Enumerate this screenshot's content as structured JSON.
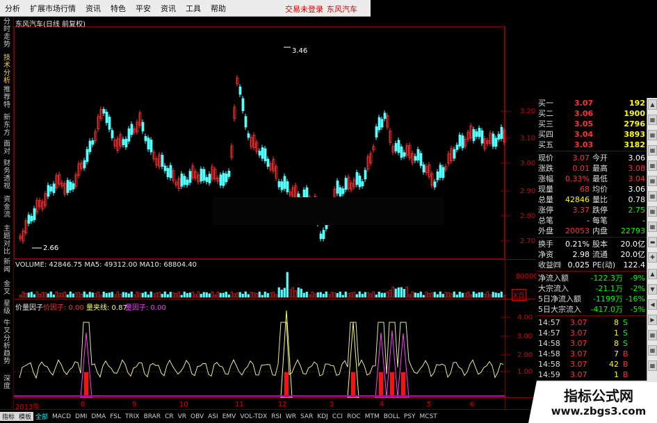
{
  "menu": {
    "items": [
      "分析",
      "扩展市场行情",
      "资讯",
      "特色",
      "平安",
      "资讯",
      "工具",
      "帮助"
    ],
    "trade_link": "交易未登录",
    "stock_link": "东风汽车"
  },
  "left_tabs": [
    "分时走势",
    "技术分析",
    "推荐特",
    "新东方",
    "面对",
    "财务透视",
    "资金流",
    "主题对比",
    "新闻",
    "金叉",
    "星级",
    "牛叉分析",
    "趋势",
    "深度"
  ],
  "chart": {
    "title": "东风汽车(日线 前复权)",
    "high_label": "3.46",
    "low_label": "2.66",
    "price_axis": [
      "3.20",
      "3.10",
      "3.00",
      "2.90",
      "2.80",
      "2.70"
    ],
    "volume_label": "VOLUME: 42846.75  MA5: 49312.00  MA10: 68804.40",
    "volume_axis": [
      "80000",
      "X百"
    ],
    "indicator_name": "价量因子",
    "indicator_items": [
      {
        "label": "价因子: 0.00",
        "color": "#ff3030"
      },
      {
        "label": "量夹线: 0.87",
        "color": "#ffff60"
      },
      {
        "label": "量因子: 0.00",
        "color": "#ff40ff"
      }
    ],
    "indicator_axis": [
      "4.00",
      "3.00",
      "2.00",
      "1.00"
    ],
    "x_axis": [
      "2013年",
      "8",
      "9",
      "10",
      "11",
      "12",
      "3",
      "4",
      "5",
      "6"
    ]
  },
  "quote": {
    "bids": [
      {
        "label": "买一",
        "price": "3.07",
        "vol": "192"
      },
      {
        "label": "买二",
        "price": "3.06",
        "vol": "1900"
      },
      {
        "label": "买三",
        "price": "3.05",
        "vol": "2796"
      },
      {
        "label": "买四",
        "price": "3.04",
        "vol": "3893"
      },
      {
        "label": "买五",
        "price": "3.03",
        "vol": "3182"
      }
    ],
    "stats": [
      {
        "l1": "现价",
        "v1": "3.07",
        "l2": "今开",
        "v2": "3.06"
      },
      {
        "l1": "涨跌",
        "v1": "0.01",
        "l2": "最高",
        "v2": "3.08"
      },
      {
        "l1": "涨幅",
        "v1": "0.33%",
        "l2": "最低",
        "v2": "3.04"
      },
      {
        "l1": "现量",
        "v1": "68",
        "l2": "均价",
        "v2": "3.06"
      },
      {
        "l1": "总量",
        "v1": "42846",
        "l2": "量比",
        "v2": "0.78"
      },
      {
        "l1": "涨停",
        "v1": "3.37",
        "l2": "跌停",
        "v2": "2.75"
      },
      {
        "l1": "总笔",
        "v1": "-",
        "l2": "每笔",
        "v2": "-"
      },
      {
        "l1": "外盘",
        "v1": "20053",
        "l2": "内盘",
        "v2": "22793"
      }
    ],
    "finance": [
      {
        "l1": "换手",
        "v1": "0.21%",
        "l2": "股本",
        "v2": "20.0亿"
      },
      {
        "l1": "净资",
        "v1": "2.98",
        "l2": "流通",
        "v2": "20.0亿"
      },
      {
        "l1": "收益㈣",
        "v1": "0.025",
        "l2": "PE(动)",
        "v2": "122.4"
      }
    ],
    "flows": [
      {
        "label": "净流入额",
        "v1": "-122.3万",
        "v2": "-9%"
      },
      {
        "label": "大宗流入",
        "v1": "-21.1万",
        "v2": "-2%"
      },
      {
        "label": "5日净流入额",
        "v1": "-1199万",
        "v2": "-16%"
      },
      {
        "label": "5日大宗流入",
        "v1": "-417.0万",
        "v2": "-5%"
      }
    ],
    "ticks": [
      {
        "time": "14:57",
        "price": "3.07",
        "vol": "8",
        "side": "S"
      },
      {
        "time": "14:57",
        "price": "3.07",
        "vol": "1",
        "side": "S"
      },
      {
        "time": "14:58",
        "price": "3.07",
        "vol": "8",
        "side": "S"
      },
      {
        "time": "14:58",
        "price": "3.07",
        "vol": "7",
        "side": "B"
      },
      {
        "time": "14:58",
        "price": "3.07",
        "vol": "42",
        "side": "B"
      },
      {
        "time": "14:59",
        "price": "3.07",
        "vol": "1",
        "side": "B"
      }
    ]
  },
  "tabs": [
    "指标",
    "模板",
    "全部",
    "MACD",
    "DMI",
    "DMA",
    "FSL",
    "TRIX",
    "BRAR",
    "CR",
    "VR",
    "OBV",
    "ASI",
    "EMV",
    "VOL-TDX",
    "RSI",
    "WR",
    "SAR",
    "KDJ",
    "CCI",
    "ROC",
    "MTM",
    "BOLL",
    "PSY",
    "MCST"
  ],
  "watermark": {
    "title": "指标公式网",
    "url": "www.zbgs3.com"
  },
  "colors": {
    "up": "#ff3232",
    "down": "#54ffff",
    "grid": "#880000",
    "yellow": "#ffff00",
    "accent_red": "#d40000"
  }
}
